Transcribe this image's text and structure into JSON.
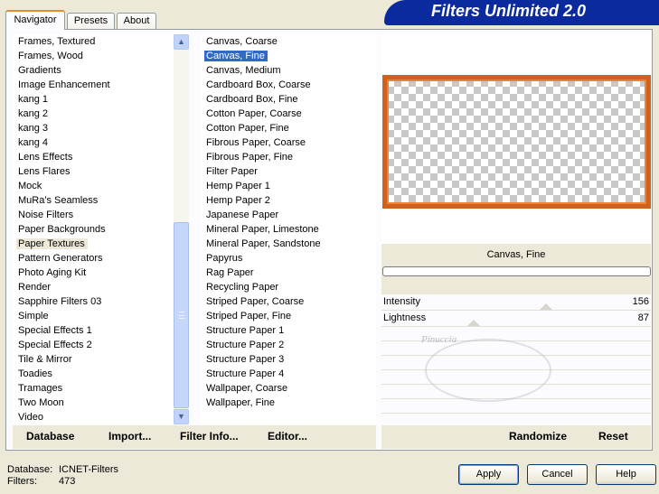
{
  "tabs": [
    {
      "label": "Navigator",
      "active": true
    },
    {
      "label": "Presets",
      "active": false
    },
    {
      "label": "About",
      "active": false
    }
  ],
  "app_title": "Filters Unlimited 2.0",
  "categories": [
    "Frames, Textured",
    "Frames, Wood",
    "Gradients",
    "Image Enhancement",
    "kang 1",
    "kang 2",
    "kang 3",
    "kang 4",
    "Lens Effects",
    "Lens Flares",
    "Mock",
    "MuRa's Seamless",
    "Noise Filters",
    "Paper Backgrounds",
    "Paper Textures",
    "Pattern Generators",
    "Photo Aging Kit",
    "Render",
    "Sapphire Filters 03",
    "Simple",
    "Special Effects 1",
    "Special Effects 2",
    "Tile & Mirror",
    "Toadies",
    "Tramages",
    "Two Moon",
    "Video"
  ],
  "selected_category": "Paper Textures",
  "filters": [
    "Canvas, Coarse",
    "Canvas, Fine",
    "Canvas, Medium",
    "Cardboard Box, Coarse",
    "Cardboard Box, Fine",
    "Cotton Paper, Coarse",
    "Cotton Paper, Fine",
    "Fibrous Paper, Coarse",
    "Fibrous Paper, Fine",
    "Filter Paper",
    "Hemp Paper 1",
    "Hemp Paper 2",
    "Japanese Paper",
    "Mineral Paper, Limestone",
    "Mineral Paper, Sandstone",
    "Papyrus",
    "Rag Paper",
    "Recycling Paper",
    "Striped Paper, Coarse",
    "Striped Paper, Fine",
    "Structure Paper 1",
    "Structure Paper 2",
    "Structure Paper 3",
    "Structure Paper 4",
    "Wallpaper, Coarse",
    "Wallpaper, Fine"
  ],
  "selected_filter": "Canvas, Fine",
  "current_filter_name": "Canvas, Fine",
  "progress": 0,
  "sliders": [
    {
      "name": "Intensity",
      "value": "156"
    },
    {
      "name": "Lightness",
      "value": "87"
    }
  ],
  "watermark": "Pinuccia",
  "left_buttons": {
    "database": "Database",
    "import": "Import...",
    "filter_info": "Filter Info...",
    "editor": "Editor..."
  },
  "right_buttons": {
    "randomize": "Randomize",
    "reset": "Reset"
  },
  "status": {
    "database_label": "Database:",
    "database_value": "ICNET-Filters",
    "filters_label": "Filters:",
    "filters_value": "473"
  },
  "dialog_buttons": {
    "apply": "Apply",
    "cancel": "Cancel",
    "help": "Help"
  },
  "colors": {
    "banner": "#0a2a9e",
    "selection": "#316ac5",
    "preview_frame": "#d2601a"
  }
}
